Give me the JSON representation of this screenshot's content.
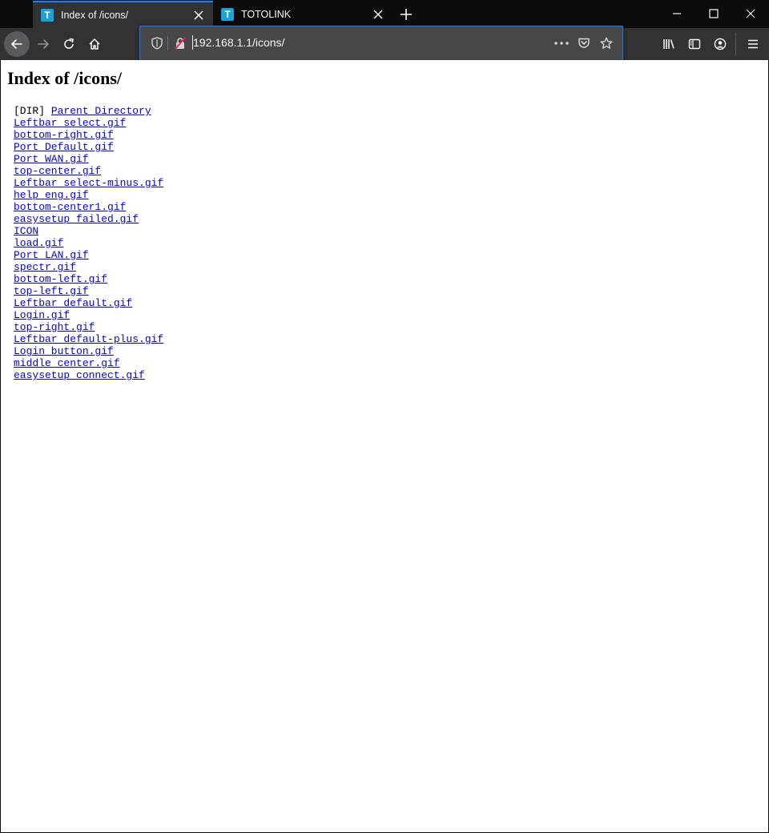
{
  "tabs": [
    {
      "label": "Index of /icons/",
      "favicon": "T",
      "active": true
    },
    {
      "label": "TOTOLINK",
      "favicon": "T",
      "active": false
    }
  ],
  "address": {
    "url": "192.168.1.1/icons/"
  },
  "page": {
    "heading": "Index of /icons/",
    "parent": {
      "tag": "[DIR]",
      "label": "Parent Directory"
    },
    "files": [
      "Leftbar_select.gif",
      "bottom-right.gif",
      "Port_Default.gif",
      "Port_WAN.gif",
      "top-center.gif",
      "Leftbar_select-minus.gif",
      "help_eng.gif",
      "bottom-center1.gif",
      "easysetup_failed.gif",
      "ICON",
      "load.gif",
      "Port_LAN.gif",
      "spectr.gif",
      "bottom-left.gif",
      "top-left.gif",
      "Leftbar_default.gif",
      "Login.gif",
      "top-right.gif",
      "Leftbar_default-plus.gif",
      "Login_button.gif",
      "middle_center.gif",
      "easysetup_connect.gif"
    ]
  },
  "colors": {
    "accent": "#0a84ff",
    "link": "#0000ee",
    "favicon": "#1aa3d8"
  }
}
